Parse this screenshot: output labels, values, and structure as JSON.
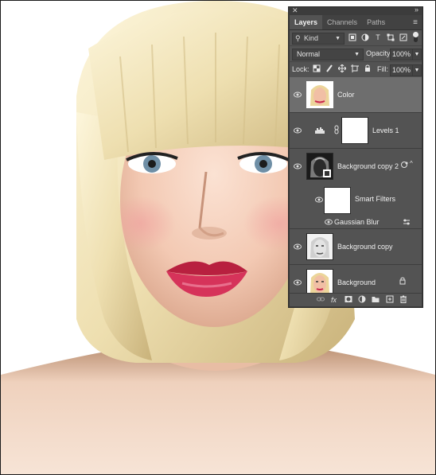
{
  "panel": {
    "close_glyph": "✕",
    "collapse_glyph": "»",
    "tabs": [
      {
        "label": "Layers",
        "active": true
      },
      {
        "label": "Channels",
        "active": false
      },
      {
        "label": "Paths",
        "active": false
      }
    ],
    "menu_icon": "panel-menu-icon",
    "filter": {
      "kind_label": "Kind",
      "icons": [
        "pixel-filter-icon",
        "adjustment-filter-icon",
        "type-filter-icon",
        "shape-filter-icon",
        "smart-object-filter-icon"
      ]
    },
    "blend_mode": "Normal",
    "opacity_label": "Opacity:",
    "opacity_value": "100%",
    "lock_label": "Lock:",
    "fill_label": "Fill:",
    "fill_value": "100%",
    "layers": [
      {
        "name": "Color",
        "selected": true
      },
      {
        "name": "Levels 1",
        "selected": false
      },
      {
        "name": "Background copy 2",
        "selected": false
      },
      {
        "name": "Smart Filters",
        "selected": false
      },
      {
        "name": "Gaussian Blur",
        "selected": false
      },
      {
        "name": "Background copy",
        "selected": false
      },
      {
        "name": "Background",
        "selected": false
      }
    ],
    "bottom_icons": [
      "link-icon",
      "fx-icon",
      "mask-icon",
      "adjustment-icon",
      "group-folder-icon",
      "new-layer-icon",
      "trash-icon"
    ],
    "fx_label": "fx"
  },
  "colors": {
    "panel_bg": "#535353",
    "selected_layer": "#6e6e6e",
    "tab_bar": "#424242",
    "lips": "#c8274a",
    "hair": "#f3ebc6"
  }
}
